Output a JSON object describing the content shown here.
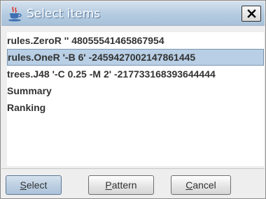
{
  "window": {
    "title": "Select items",
    "close_glyph": "X",
    "app_icon": "java-cup-icon"
  },
  "list": {
    "items": [
      {
        "label": "rules.ZeroR '' 48055541465867954",
        "selected": false
      },
      {
        "label": "rules.OneR '-B 6' -2459427002147861445",
        "selected": true
      },
      {
        "label": "trees.J48 '-C 0.25 -M 2' -217733168393644444",
        "selected": false
      },
      {
        "label": "Summary",
        "selected": false
      },
      {
        "label": "Ranking",
        "selected": false
      }
    ]
  },
  "buttons": {
    "select": {
      "mnemonic": "S",
      "rest": "elect"
    },
    "pattern": {
      "mnemonic": "P",
      "rest": "attern"
    },
    "cancel": {
      "mnemonic": "C",
      "rest": "ancel"
    }
  },
  "colors": {
    "selection_bg": "#b8cfe5",
    "titlebar": "#b4cbe0"
  }
}
